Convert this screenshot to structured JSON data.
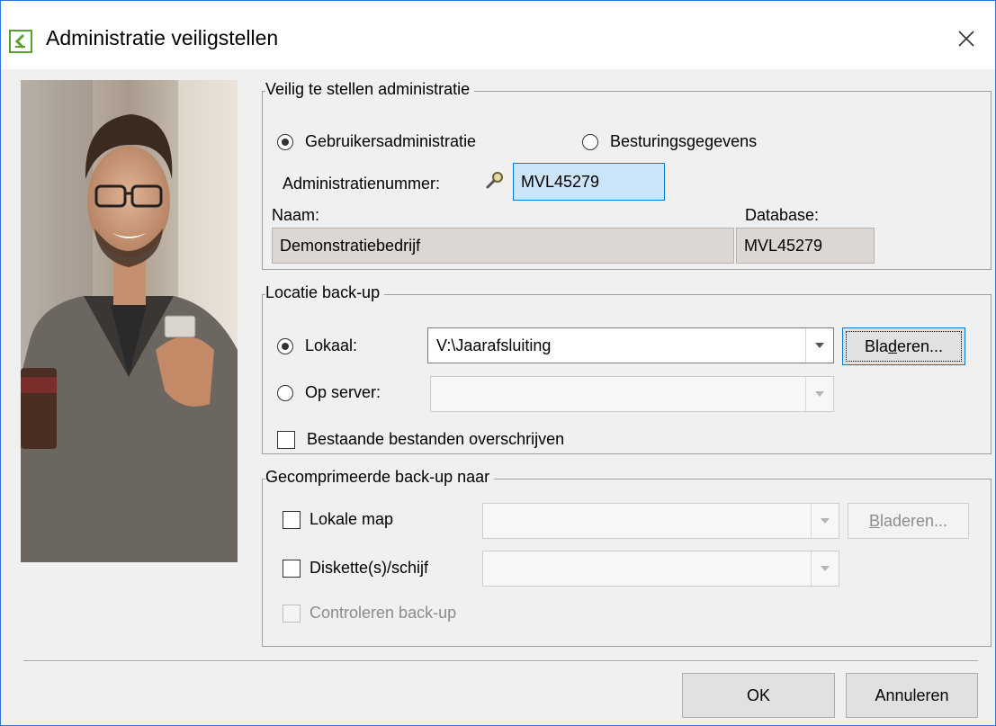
{
  "window": {
    "title": "Administratie veiligstellen"
  },
  "section_admin": {
    "legend": "Veilig te stellen administratie",
    "radio_user": "Gebruikersadministratie",
    "radio_control": "Besturingsgegevens",
    "admin_number_label": "Administratienummer:",
    "admin_number_value": "MVL45279",
    "name_label": "Naam:",
    "name_value": "Demonstratiebedrijf",
    "database_label": "Database:",
    "database_value": "MVL45279"
  },
  "section_location": {
    "legend": "Locatie back-up",
    "local_label": "Lokaal:",
    "local_path": "V:\\Jaarafsluiting",
    "browse_pre": "Bla",
    "browse_mnemonic": "d",
    "browse_post": "eren...",
    "server_label": "Op server:",
    "server_value": "",
    "overwrite_label": "Bestaande bestanden overschrijven"
  },
  "section_compressed": {
    "legend": "Gecomprimeerde back-up naar",
    "local_folder_label": "Lokale map",
    "local_folder_value": "",
    "browse_mnemonic": "B",
    "browse_post": "laderen...",
    "disk_label": "Diskette(s)/schijf",
    "disk_value": "",
    "verify_label": "Controleren back-up"
  },
  "buttons": {
    "ok": "OK",
    "cancel": "Annuleren"
  },
  "icons": {
    "app": "app-icon",
    "close": "close-icon",
    "lookup": "magnifier-icon",
    "dropdown": "chevron-down-icon"
  }
}
